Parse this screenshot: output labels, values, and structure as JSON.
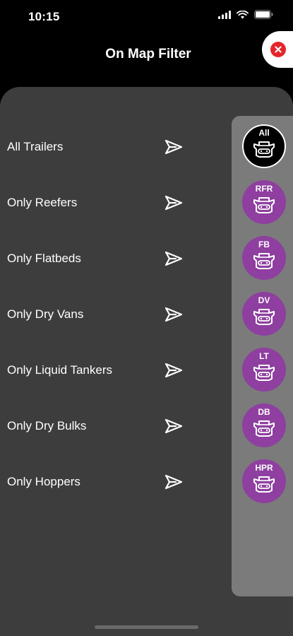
{
  "status": {
    "time": "10:15"
  },
  "header": {
    "title": "On Map Filter"
  },
  "filters": [
    {
      "label": "All Trailers",
      "code": "All",
      "variant": "black"
    },
    {
      "label": "Only Reefers",
      "code": "RFR",
      "variant": "purple"
    },
    {
      "label": "Only Flatbeds",
      "code": "FB",
      "variant": "purple"
    },
    {
      "label": "Only Dry Vans",
      "code": "DV",
      "variant": "purple"
    },
    {
      "label": "Only Liquid Tankers",
      "code": "LT",
      "variant": "purple"
    },
    {
      "label": "Only Dry Bulks",
      "code": "DB",
      "variant": "purple"
    },
    {
      "label": "Only Hoppers",
      "code": "HPR",
      "variant": "purple"
    }
  ],
  "icons": {
    "row_action": "send-arrow-icon",
    "badge": "truck-front-icon",
    "close": "close-icon"
  },
  "colors": {
    "background": "#000000",
    "panel": "#3d3d3d",
    "rail": "#7b7b7b",
    "badge_purple": "#8e3f9f",
    "close_red": "#e5252a"
  }
}
